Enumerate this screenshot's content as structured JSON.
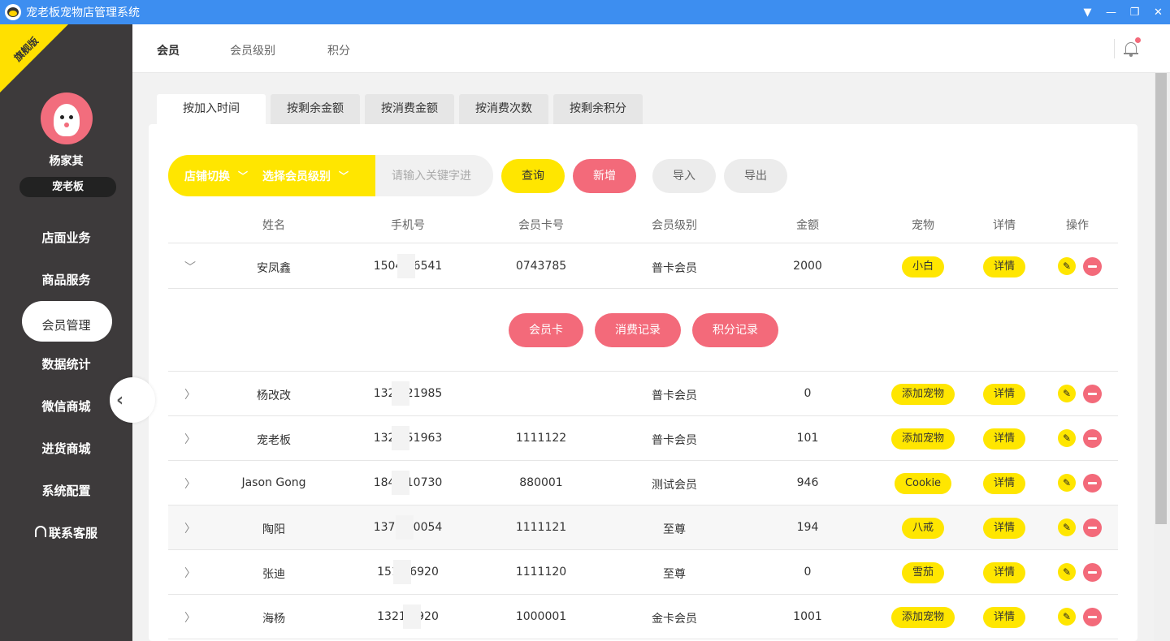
{
  "window": {
    "title": "宠老板宠物店管理系统"
  },
  "sidebar": {
    "ribbon": "旗舰版",
    "username": "杨家其",
    "store": "宠老板",
    "items": [
      {
        "label": "店面业务"
      },
      {
        "label": "商品服务"
      },
      {
        "label": "会员管理"
      },
      {
        "label": "数据统计"
      },
      {
        "label": "微信商城"
      },
      {
        "label": "进货商城"
      },
      {
        "label": "系统配置"
      },
      {
        "label": "联系客服"
      }
    ],
    "active_index": 2
  },
  "topbar": {
    "tabs": [
      {
        "label": "会员"
      },
      {
        "label": "会员级别"
      },
      {
        "label": "积分"
      }
    ],
    "active_tab": 0
  },
  "sort_tabs": [
    {
      "label": "按加入时间"
    },
    {
      "label": "按剩余金额"
    },
    {
      "label": "按消费金额"
    },
    {
      "label": "按消费次数"
    },
    {
      "label": "按剩余积分"
    }
  ],
  "filter": {
    "store_select": "店铺切换",
    "level_select": "选择会员级别",
    "keyword_placeholder": "请输入关键字进",
    "query_label": "查询",
    "add_label": "新增",
    "import_label": "导入",
    "export_label": "导出"
  },
  "table": {
    "headers": [
      "姓名",
      "手机号",
      "会员卡号",
      "会员级别",
      "金额",
      "宠物",
      "详情",
      "操作"
    ],
    "detail_label": "详情",
    "expanded_actions": [
      "会员卡",
      "消费记录",
      "积分记录"
    ],
    "rows": [
      {
        "name": "安凤鑫",
        "phone": "1504  96541",
        "card": "0743785",
        "level": "普卡会员",
        "amount": "2000",
        "pet": "小白",
        "expanded": true
      },
      {
        "name": "杨改改",
        "phone": "132  321985",
        "card": "",
        "level": "普卡会员",
        "amount": "0",
        "pet": "添加宠物"
      },
      {
        "name": "宠老板",
        "phone": "132  351963",
        "card": "1111122",
        "level": "普卡会员",
        "amount": "101",
        "pet": "添加宠物"
      },
      {
        "name": "Jason Gong",
        "phone": "184  310730",
        "card": "880001",
        "level": "测试会员",
        "amount": "946",
        "pet": "Cookie"
      },
      {
        "name": "陶阳",
        "phone": "1378  00054",
        "card": "1111121",
        "level": "至尊",
        "amount": "194",
        "pet": "八戒"
      },
      {
        "name": "张迪",
        "phone": "151  16920",
        "card": "1111120",
        "level": "至尊",
        "amount": "0",
        "pet": "雪茄"
      },
      {
        "name": "海杨",
        "phone": "1321  1920",
        "card": "1000001",
        "level": "金卡会员",
        "amount": "1001",
        "pet": "添加宠物"
      }
    ]
  }
}
